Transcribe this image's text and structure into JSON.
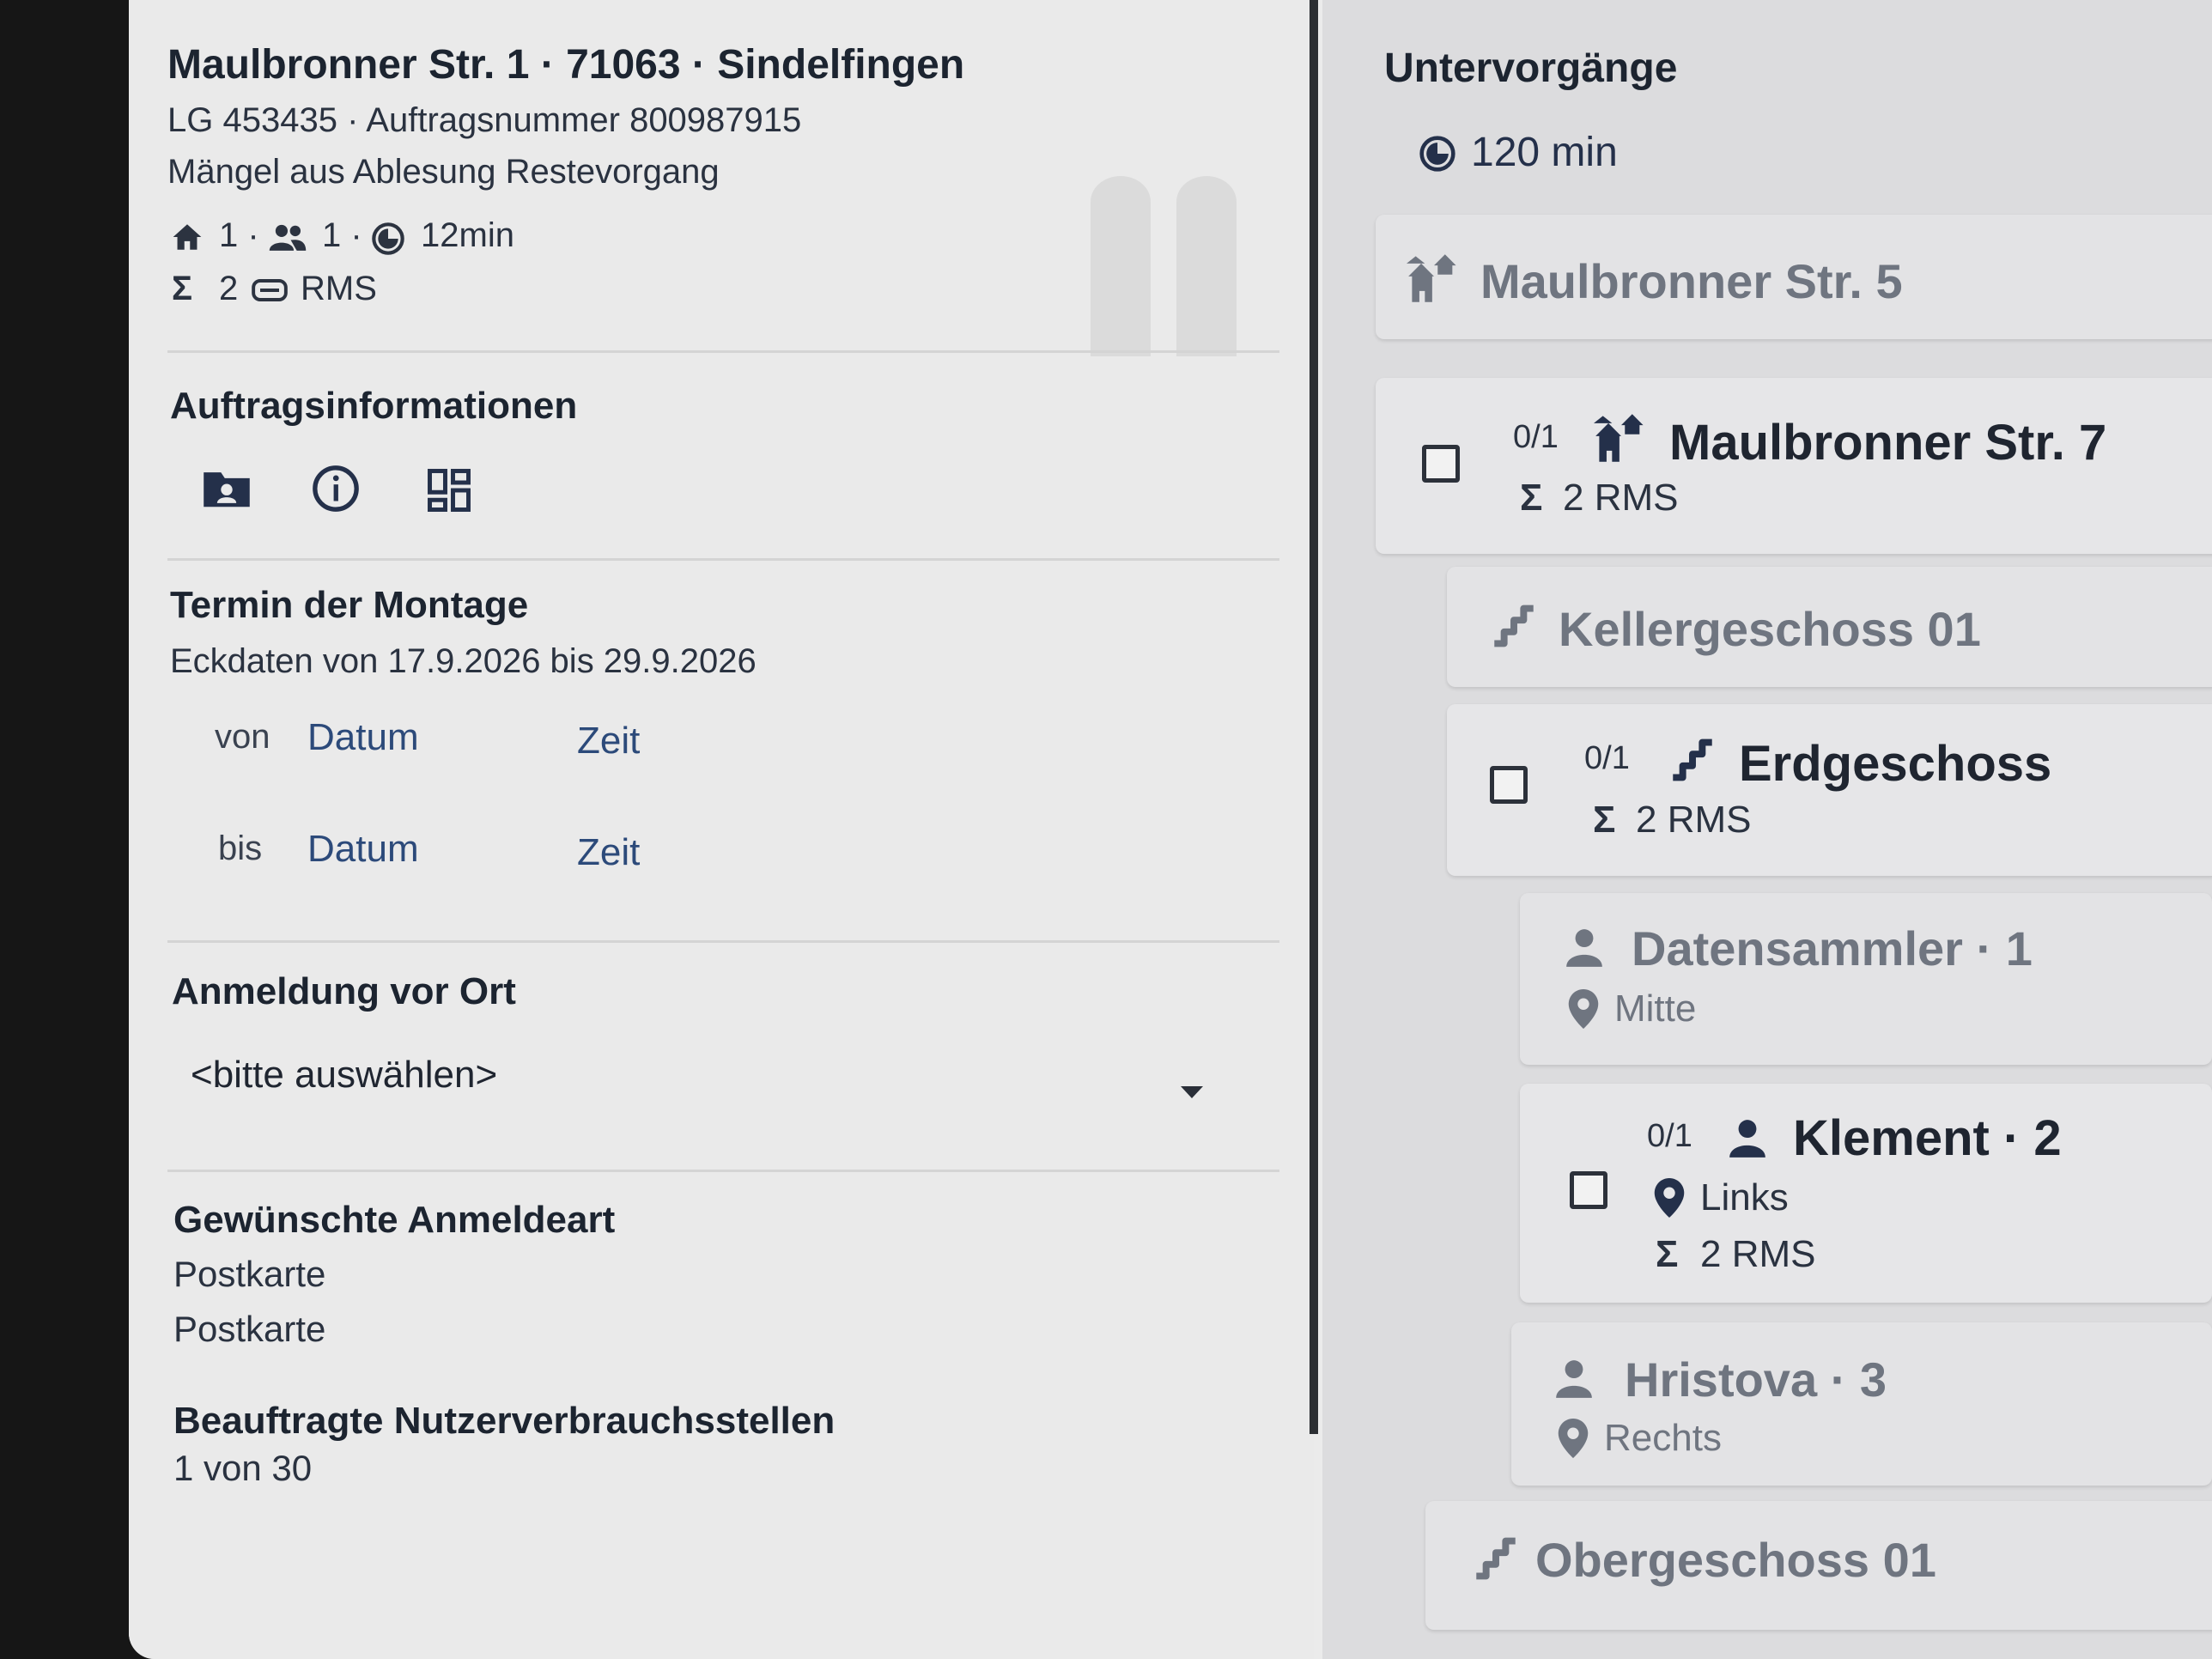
{
  "left": {
    "address": "Maulbronner Str. 1 · 71063 · Sindelfingen",
    "order_line": "LG 453435 · Auftragsnummer 800987915",
    "description": "Mängel aus Ablesung Restevorgang",
    "stats": {
      "houses": "1 ·",
      "persons": "1 ·",
      "duration": "12min",
      "sum": "2",
      "unit": "RMS"
    },
    "order_info_title": "Auftragsinformationen",
    "appointment": {
      "title": "Termin der Montage",
      "range": "Eckdaten von 17.9.2026 bis 29.9.2026",
      "from_label": "von",
      "to_label": "bis",
      "date_placeholder": "Datum",
      "time_placeholder": "Zeit"
    },
    "registration": {
      "title": "Anmeldung vor Ort",
      "selected": "<bitte auswählen>"
    },
    "desired_type": {
      "title": "Gewünschte Anmeldeart",
      "value1": "Postkarte",
      "value2": "Postkarte"
    },
    "commissioned": {
      "title": "Beauftragte Nutzerverbrauchsstellen",
      "value": "1 von 30"
    }
  },
  "right": {
    "title": "Untervorgänge",
    "total_duration": "120 min",
    "items": [
      {
        "title": "Maulbronner Str. 5"
      },
      {
        "fraction": "0/1",
        "title": "Maulbronner Str. 7",
        "sum": "2 RMS"
      },
      {
        "title": "Kellergeschoss 01"
      },
      {
        "fraction": "0/1",
        "title": "Erdgeschoss",
        "sum": "2 RMS"
      },
      {
        "title": "Datensammler · 1",
        "location": "Mitte"
      },
      {
        "fraction": "0/1",
        "title": "Klement · 2",
        "location": "Links",
        "sum": "2 RMS"
      },
      {
        "title": "Hristova · 3",
        "location": "Rechts"
      },
      {
        "title": "Obergeschoss 01"
      }
    ]
  },
  "colors": {
    "accent_blue": "#2c4a7a",
    "text_dark": "#1c2430",
    "text_grey": "#6f7580"
  },
  "icons": [
    "home-icon",
    "people-icon",
    "timer-icon",
    "sigma-icon",
    "meter-icon",
    "folder-person-icon",
    "info-icon",
    "dashboard-icon",
    "houses-icon",
    "stairs-icon",
    "person-icon",
    "location-pin-icon",
    "dropdown-arrow-icon"
  ]
}
